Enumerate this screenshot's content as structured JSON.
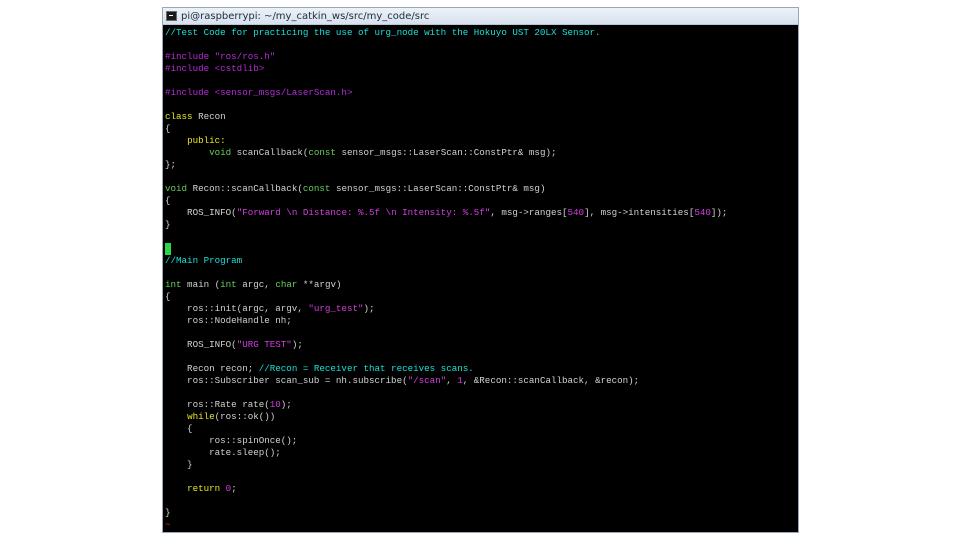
{
  "window": {
    "title": "pi@raspberrypi: ~/my_catkin_ws/src/my_code/src"
  },
  "colors": {
    "comment": "#18e0d8",
    "preprocessor": "#b52cd9",
    "keyword": "#e7e722",
    "type": "#66d05c",
    "string": "#d43de2",
    "text": "#d2d2d2",
    "cursor": "#29d64a",
    "background": "#000000"
  },
  "lines": [
    [
      {
        "t": "//Test Code for practicing the use of urg_node with the Hokuyo UST 20LX Sensor.",
        "c": "comment"
      }
    ],
    [],
    [
      {
        "t": "#include \"ros/ros.h\"",
        "c": "preproc"
      }
    ],
    [
      {
        "t": "#include <cstdlib>",
        "c": "preproc"
      }
    ],
    [],
    [
      {
        "t": "#include <sensor_msgs/LaserScan.h>",
        "c": "preproc"
      }
    ],
    [],
    [
      {
        "t": "class",
        "c": "keyword"
      },
      {
        "t": " Recon",
        "c": "normal"
      }
    ],
    [
      {
        "t": "{",
        "c": "normal"
      }
    ],
    [
      {
        "t": "    ",
        "c": "normal"
      },
      {
        "t": "public:",
        "c": "keyword"
      }
    ],
    [
      {
        "t": "        ",
        "c": "normal"
      },
      {
        "t": "void",
        "c": "type"
      },
      {
        "t": " scanCallback(",
        "c": "normal"
      },
      {
        "t": "const",
        "c": "type"
      },
      {
        "t": " sensor_msgs::LaserScan::ConstPtr& msg);",
        "c": "normal"
      }
    ],
    [
      {
        "t": "};",
        "c": "normal"
      }
    ],
    [],
    [
      {
        "t": "void",
        "c": "type"
      },
      {
        "t": " Recon::scanCallback(",
        "c": "normal"
      },
      {
        "t": "const",
        "c": "type"
      },
      {
        "t": " sensor_msgs::LaserScan::ConstPtr& msg)",
        "c": "normal"
      }
    ],
    [
      {
        "t": "{",
        "c": "normal"
      }
    ],
    [
      {
        "t": "    ROS_INFO(",
        "c": "normal"
      },
      {
        "t": "\"Forward \\n Distance: %.5f \\n Intensity: %.5f\"",
        "c": "string"
      },
      {
        "t": ", msg->ranges[",
        "c": "normal"
      },
      {
        "t": "540",
        "c": "number"
      },
      {
        "t": "], msg->intensities[",
        "c": "normal"
      },
      {
        "t": "540",
        "c": "number"
      },
      {
        "t": "]);",
        "c": "normal"
      }
    ],
    [
      {
        "t": "}",
        "c": "normal"
      }
    ],
    [],
    [
      {
        "t": "",
        "c": "cursor"
      }
    ],
    [
      {
        "t": "//Main Program",
        "c": "comment"
      }
    ],
    [],
    [
      {
        "t": "int",
        "c": "type"
      },
      {
        "t": " main (",
        "c": "normal"
      },
      {
        "t": "int",
        "c": "type"
      },
      {
        "t": " argc, ",
        "c": "normal"
      },
      {
        "t": "char",
        "c": "type"
      },
      {
        "t": " **argv)",
        "c": "normal"
      }
    ],
    [
      {
        "t": "{",
        "c": "normal"
      }
    ],
    [
      {
        "t": "    ros::init(argc, argv, ",
        "c": "normal"
      },
      {
        "t": "\"urg_test\"",
        "c": "string"
      },
      {
        "t": ");",
        "c": "normal"
      }
    ],
    [
      {
        "t": "    ros::NodeHandle nh;",
        "c": "normal"
      }
    ],
    [],
    [
      {
        "t": "    ROS_INFO(",
        "c": "normal"
      },
      {
        "t": "\"URG TEST\"",
        "c": "string"
      },
      {
        "t": ");",
        "c": "normal"
      }
    ],
    [],
    [
      {
        "t": "    Recon recon; ",
        "c": "normal"
      },
      {
        "t": "//Recon = Receiver that receives scans.",
        "c": "comment"
      }
    ],
    [
      {
        "t": "    ros::Subscriber scan_sub = nh.subscribe(",
        "c": "normal"
      },
      {
        "t": "\"/scan\"",
        "c": "string"
      },
      {
        "t": ", ",
        "c": "normal"
      },
      {
        "t": "1",
        "c": "number"
      },
      {
        "t": ", &Recon::scanCallback, &recon);",
        "c": "normal"
      }
    ],
    [],
    [
      {
        "t": "    ros::Rate rate(",
        "c": "normal"
      },
      {
        "t": "10",
        "c": "number"
      },
      {
        "t": ");",
        "c": "normal"
      }
    ],
    [
      {
        "t": "    ",
        "c": "normal"
      },
      {
        "t": "while",
        "c": "keyword"
      },
      {
        "t": "(ros::ok())",
        "c": "normal"
      }
    ],
    [
      {
        "t": "    {",
        "c": "normal"
      }
    ],
    [
      {
        "t": "        ros::spinOnce();",
        "c": "normal"
      }
    ],
    [
      {
        "t": "        rate.sleep();",
        "c": "normal"
      }
    ],
    [
      {
        "t": "    }",
        "c": "normal"
      }
    ],
    [],
    [
      {
        "t": "    ",
        "c": "normal"
      },
      {
        "t": "return",
        "c": "keyword"
      },
      {
        "t": " ",
        "c": "normal"
      },
      {
        "t": "0",
        "c": "number"
      },
      {
        "t": ";",
        "c": "normal"
      }
    ],
    [],
    [
      {
        "t": "}",
        "c": "normal"
      }
    ],
    [
      {
        "t": "~",
        "c": "tilde"
      }
    ]
  ]
}
